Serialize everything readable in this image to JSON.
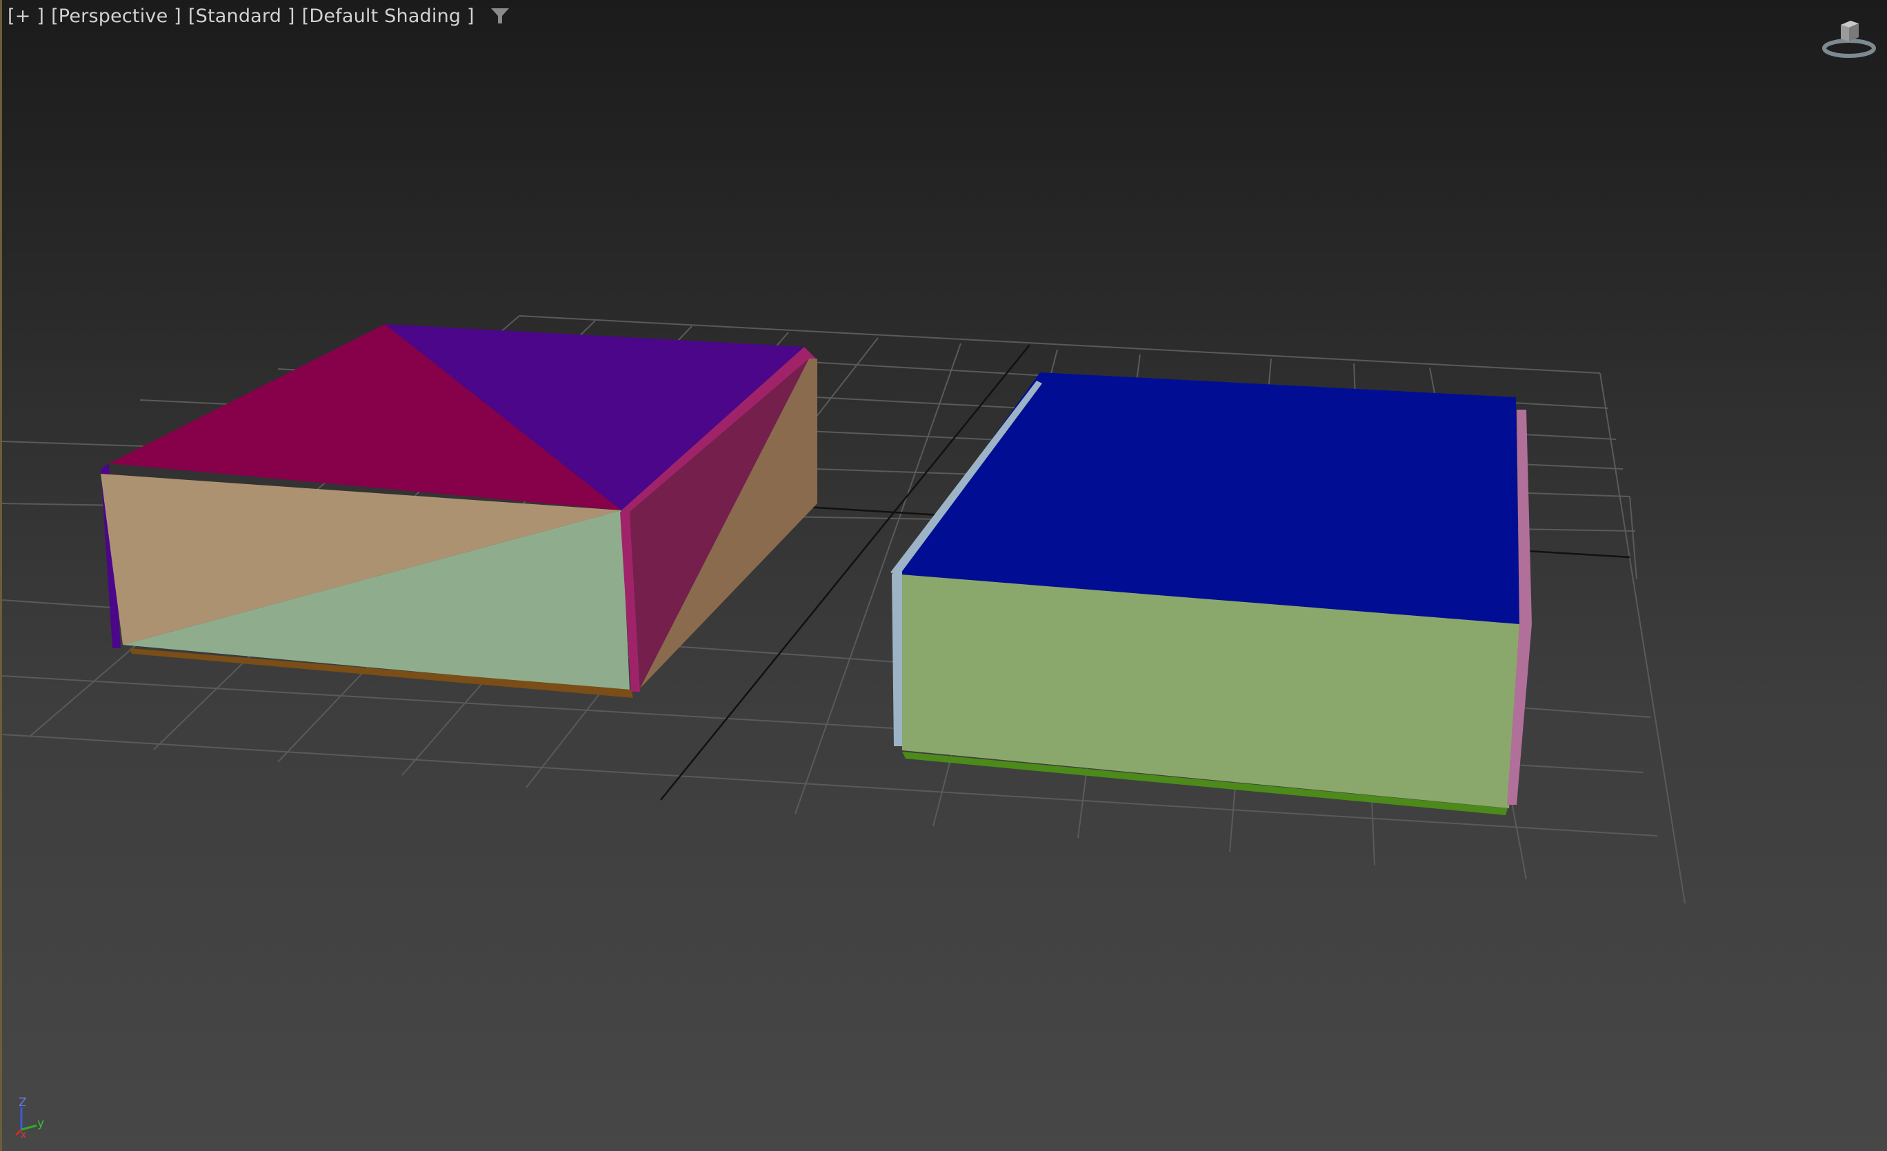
{
  "viewport": {
    "label_plus": "[+ ]",
    "label_view": "[Perspective ]",
    "label_mode": "[Standard ]",
    "label_shading": "[Default Shading ]",
    "icons": {
      "filter": "filter-icon",
      "viewcube": "viewcube-icon",
      "axis_tripod": "axis-tripod-icon"
    },
    "axis_tripod": {
      "z": "Z",
      "y": "y",
      "x": "x"
    }
  },
  "colors": {
    "grid": "#5a5a5a",
    "grid_axis": "#111111",
    "box1": {
      "top_left": "#86004a",
      "top_right": "#4b068a",
      "front_a": "#ad9272",
      "front_b": "#8fad8d",
      "side_a": "#741f4c",
      "side_b": "#8a6b4e",
      "edge_pink": "#a0236a",
      "edge_bottom": "#7a4e16"
    },
    "box2": {
      "top": "#010e94",
      "front": "#8aa86c",
      "edge_left": "#9db4c6",
      "edge_right": "#b0709a",
      "edge_bottom": "#4c8a1a"
    }
  }
}
